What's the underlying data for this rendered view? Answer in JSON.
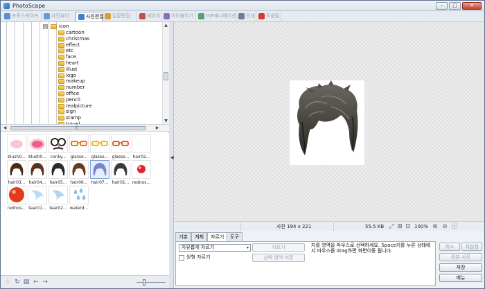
{
  "window": {
    "title": "PhotoScape",
    "controls": {
      "minimize": "–",
      "maximize": "□",
      "close": "✕"
    }
  },
  "tabs": [
    {
      "label": "포토스케이프",
      "icon": "photoscape-icon",
      "color": "#5a8fd0",
      "active": false
    },
    {
      "label": "사진뷰어",
      "icon": "viewer-icon",
      "color": "#6b9bd6",
      "active": false
    },
    {
      "label": "사진편집",
      "icon": "editor-icon",
      "color": "#3d7fc8",
      "active": true
    },
    {
      "label": "일괄편집",
      "icon": "batch-icon",
      "color": "#d6a03a",
      "active": false
    },
    {
      "label": "페이지",
      "icon": "page-icon",
      "color": "#c0504d",
      "active": false
    },
    {
      "label": "이어붙이기",
      "icon": "combine-icon",
      "color": "#8a6fbf",
      "active": false
    },
    {
      "label": "GIF애니메이션",
      "icon": "gif-icon",
      "color": "#4fa36b",
      "active": false
    },
    {
      "label": "인쇄",
      "icon": "print-icon",
      "color": "#6a7f95",
      "active": false
    },
    {
      "label": "도움말",
      "icon": "help-icon",
      "color": "#d23b2e",
      "active": false
    }
  ],
  "tree": {
    "root": "icon",
    "expander": "⊟",
    "items": [
      "cartoon",
      "christmas",
      "effect",
      "etc",
      "face",
      "heart",
      "illust",
      "logo",
      "makeup",
      "number",
      "office",
      "pencil",
      "realpicture",
      "sign",
      "stamp",
      "travel"
    ],
    "scroll_up": "▲",
    "scroll_down": "▼",
    "scroll_left": "◀",
    "scroll_right": "▶",
    "grip": "|||"
  },
  "thumbnails": [
    {
      "caption": "blush0...",
      "kind": "blush",
      "color": "#f2a3b4"
    },
    {
      "caption": "blush0...",
      "kind": "blush2",
      "color": "#ef5f8f"
    },
    {
      "caption": "conky...",
      "kind": "glasses-nose",
      "color": "#222222"
    },
    {
      "caption": "glasse...",
      "kind": "glasses",
      "color": "#d84a2e"
    },
    {
      "caption": "glasse...",
      "kind": "glasses",
      "color": "#e3a21d"
    },
    {
      "caption": "glasse...",
      "kind": "glasses",
      "color": "#c8323a"
    },
    {
      "caption": "hair02...",
      "kind": "blank",
      "color": "#ffffff"
    },
    {
      "caption": "hair03...",
      "kind": "hair",
      "color": "#4a2a18"
    },
    {
      "caption": "hair04...",
      "kind": "hair",
      "color": "#5a3220"
    },
    {
      "caption": "hair05...",
      "kind": "hair",
      "color": "#2a2a2a"
    },
    {
      "caption": "hair06...",
      "kind": "hair",
      "color": "#6b3a1e"
    },
    {
      "caption": "hair07...",
      "kind": "hair",
      "color": "#7a86c8"
    },
    {
      "caption": "hair01...",
      "kind": "hair",
      "color": "#3a3a3a"
    },
    {
      "caption": "rednos...",
      "kind": "nose",
      "color": "#e0252a"
    },
    {
      "caption": "rednos...",
      "kind": "nose-big",
      "color": "#e23a1c"
    },
    {
      "caption": "tear01...",
      "kind": "tear",
      "color": "#a7d3f0"
    },
    {
      "caption": "tear02...",
      "kind": "tear",
      "color": "#9ccbee"
    },
    {
      "caption": "waterd...",
      "kind": "drops",
      "color": "#7fc0ea"
    }
  ],
  "left_toolbar": [
    "☆",
    "↻",
    "▤",
    "←",
    "→"
  ],
  "status": {
    "photo_size": "사진 194 x 221",
    "file_size": "55.5 KB",
    "zoom": "100%",
    "icons": [
      "⤢",
      "⊞",
      "⊡",
      "⊕",
      "⊖",
      "ⓘ"
    ]
  },
  "editor": {
    "tabs": [
      {
        "label": "기본",
        "active": false
      },
      {
        "label": "개체",
        "active": false
      },
      {
        "label": "자르기",
        "active": true
      },
      {
        "label": "도구",
        "active": false
      }
    ],
    "crop_mode": "자유롭게 자르기",
    "caret": "▾",
    "round_crop_label": "원형 자르기",
    "crop_button": "자르기",
    "save_selection_button": "선택 영역 저장",
    "help_text": "자를 영역을 마우스로 선택하세요. Space키를 누른 상태에서 마우스를 drag하면 화면이동 됩니다."
  },
  "right_buttons": {
    "undo": "취소",
    "redo": "재실행",
    "original": "원본 사진",
    "save": "저장",
    "menu": "메뉴"
  }
}
